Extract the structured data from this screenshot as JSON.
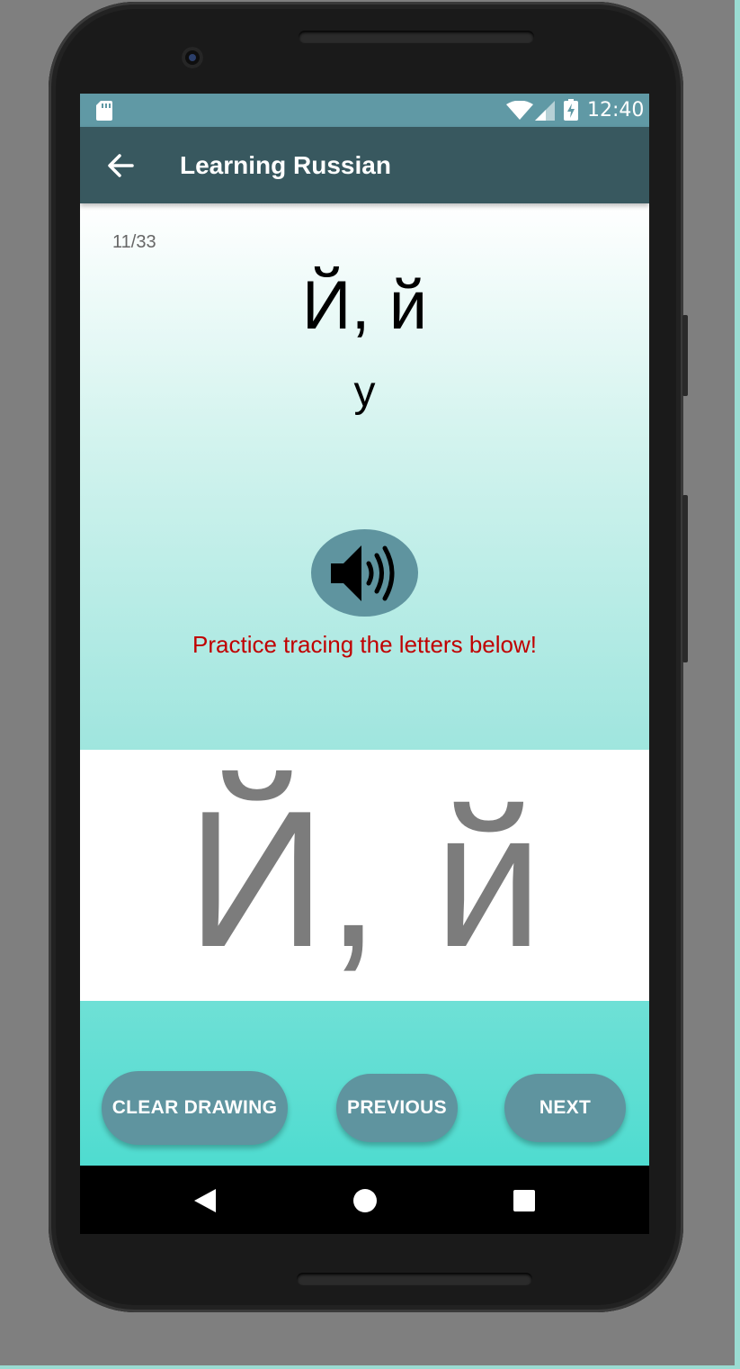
{
  "status_bar": {
    "time": "12:40",
    "icons": [
      "sd-card-icon",
      "wifi-icon",
      "signal-icon",
      "battery-charging-icon"
    ]
  },
  "app_bar": {
    "title": "Learning Russian",
    "back_icon": "arrow-left-icon"
  },
  "lesson": {
    "counter": "11/33",
    "letter": "Й, й",
    "transliteration": "y",
    "sound_icon": "speaker-volume-icon",
    "instruction": "Practice tracing the letters below!",
    "trace_letter": "Й, й"
  },
  "buttons": {
    "clear": "CLEAR DRAWING",
    "previous": "PREVIOUS",
    "next": "NEXT"
  },
  "nav_bar": {
    "icons": [
      "nav-back-icon",
      "nav-home-icon",
      "nav-recents-icon"
    ]
  },
  "colors": {
    "status_bar": "#6099a5",
    "app_bar": "#38585f",
    "button": "#5f949f",
    "instruction_text": "#c00000",
    "trace_letter": "#7c7c7c"
  }
}
